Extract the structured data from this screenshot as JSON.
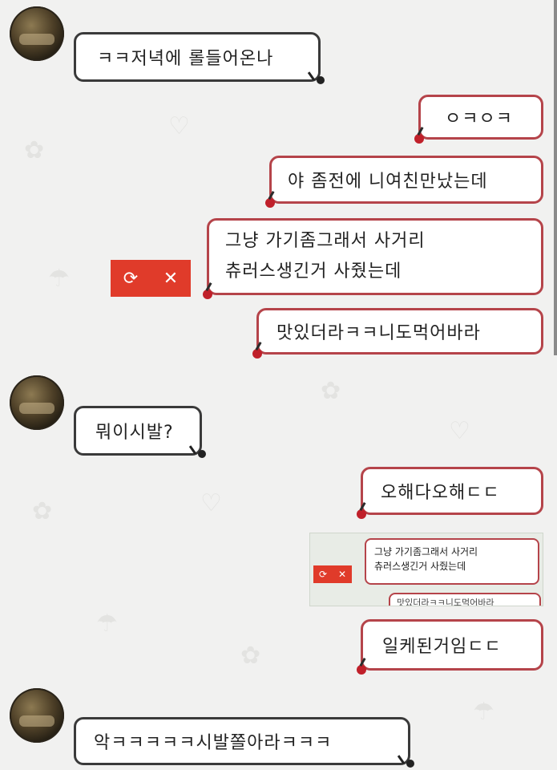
{
  "messages": [
    {
      "side": "them",
      "text": "ㅋㅋ저녁에 롤들어온나"
    },
    {
      "side": "me",
      "text": "ㅇㅋㅇㅋ"
    },
    {
      "side": "me",
      "text": "야 좀전에 니여친만났는데"
    },
    {
      "side": "me",
      "line1": "그냥 가기좀그래서 사거리",
      "line2": "츄러스생긴거 사줬는데"
    },
    {
      "side": "me",
      "text": "맛있더라ㅋㅋ니도먹어바라"
    },
    {
      "side": "them",
      "text": "뭐이시발?"
    },
    {
      "side": "me",
      "text": "오해다오해ㄷㄷ"
    },
    {
      "side": "me",
      "text": "일케된거임ㄷㄷ"
    },
    {
      "side": "them",
      "text": "악ㅋㅋㅋㅋㅋ시발쫄아라ㅋㅋㅋ"
    }
  ],
  "send_failed": {
    "retry_icon": "⟳",
    "cancel_icon": "✕"
  },
  "embedded_screenshot": {
    "line1": "그냥 가기좀그래서 사거리",
    "line2": "츄러스생긴거 사줬는데",
    "partial": "맛있더라ㅋㅋ니도먹어바라"
  },
  "colors": {
    "their_border": "#3a3a3a",
    "my_border": "#b5444a",
    "fail": "#e03b2a"
  }
}
